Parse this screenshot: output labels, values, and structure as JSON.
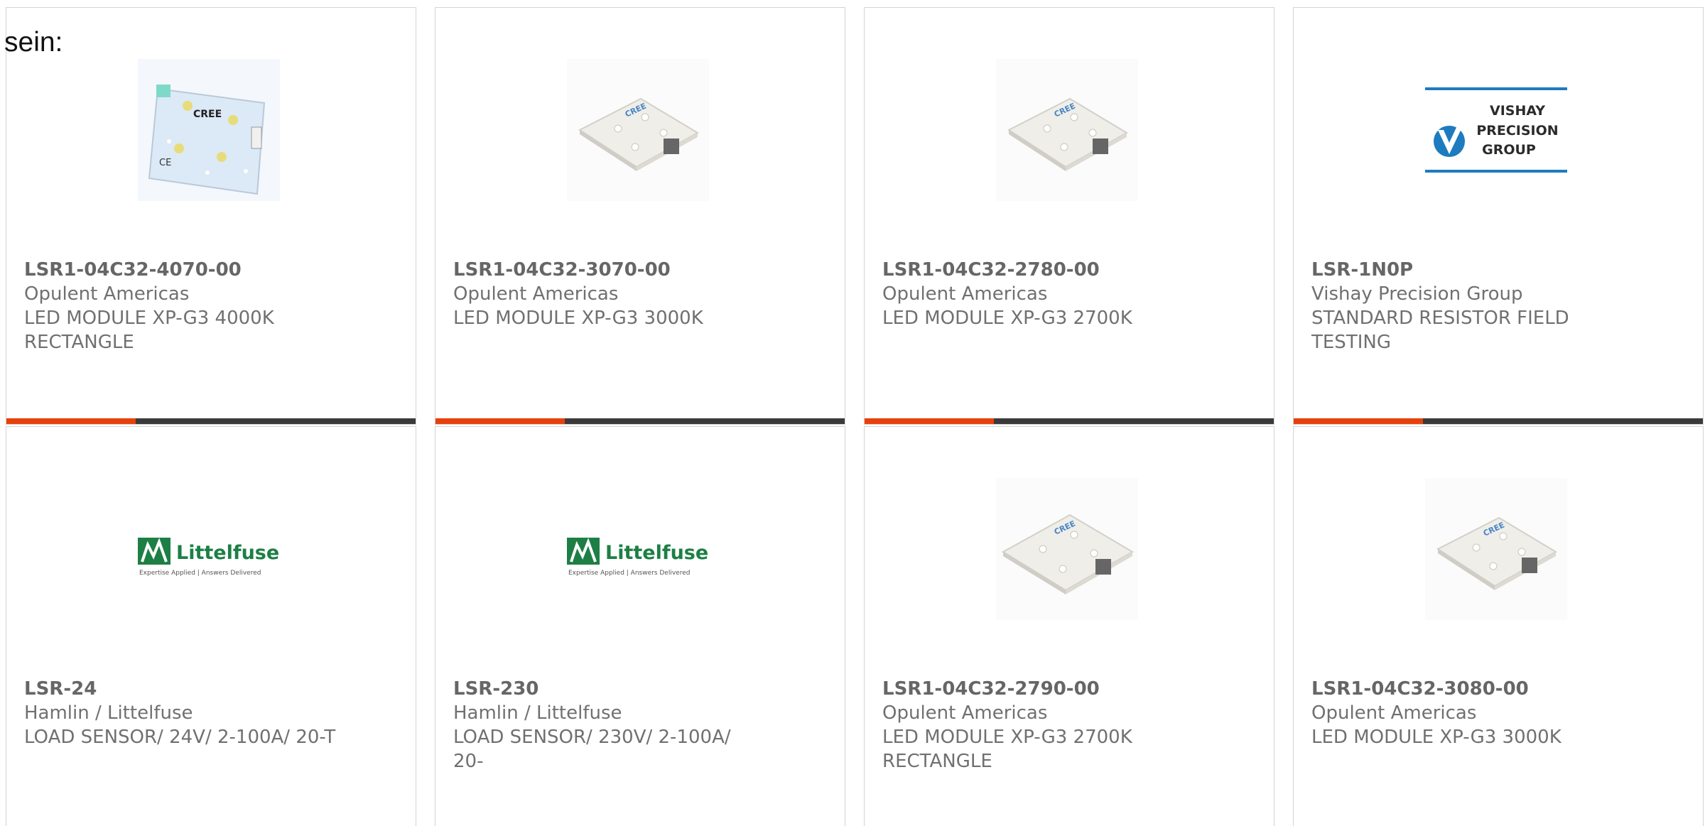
{
  "page_fragment": "sein:",
  "colors": {
    "accent": "#e8400c",
    "bar": "#3a3a3a",
    "text": "#707070",
    "border": "#d4d4d4"
  },
  "products": [
    {
      "part_number": "LSR1-04C32-4070-00",
      "manufacturer": "Opulent Americas",
      "description": "LED MODULE XP-G3 4000K RECTANGLE",
      "image": "cree-led-module-board"
    },
    {
      "part_number": "LSR1-04C32-3070-00",
      "manufacturer": "Opulent Americas",
      "description": "LED MODULE XP-G3 3000K",
      "image": "led-module-board"
    },
    {
      "part_number": "LSR1-04C32-2780-00",
      "manufacturer": "Opulent Americas",
      "description": "LED MODULE XP-G3 2700K",
      "image": "led-module-board"
    },
    {
      "part_number": "LSR-1N0P",
      "manufacturer": "Vishay Precision Group",
      "description": "STANDARD RESISTOR FIELD TESTING",
      "image": "vishay-logo",
      "logo": {
        "line1": "VISHAY",
        "line2": "PRECISION",
        "line3": "GROUP"
      }
    },
    {
      "part_number": "LSR-24",
      "manufacturer": "Hamlin / Littelfuse",
      "description": "LOAD SENSOR/ 24V/ 2-100A/ 20-T",
      "image": "littelfuse-logo",
      "logo": {
        "name": "Littelfuse",
        "tagline": "Expertise Applied | Answers Delivered"
      }
    },
    {
      "part_number": "LSR-230",
      "manufacturer": "Hamlin / Littelfuse",
      "description": "LOAD SENSOR/ 230V/ 2-100A/ 20-",
      "image": "littelfuse-logo",
      "logo": {
        "name": "Littelfuse",
        "tagline": "Expertise Applied | Answers Delivered"
      }
    },
    {
      "part_number": "LSR1-04C32-2790-00",
      "manufacturer": "Opulent Americas",
      "description": "LED MODULE XP-G3 2700K RECTANGLE",
      "image": "led-module-board"
    },
    {
      "part_number": "LSR1-04C32-3080-00",
      "manufacturer": "Opulent Americas",
      "description": "LED MODULE XP-G3 3000K",
      "image": "led-module-board"
    }
  ]
}
